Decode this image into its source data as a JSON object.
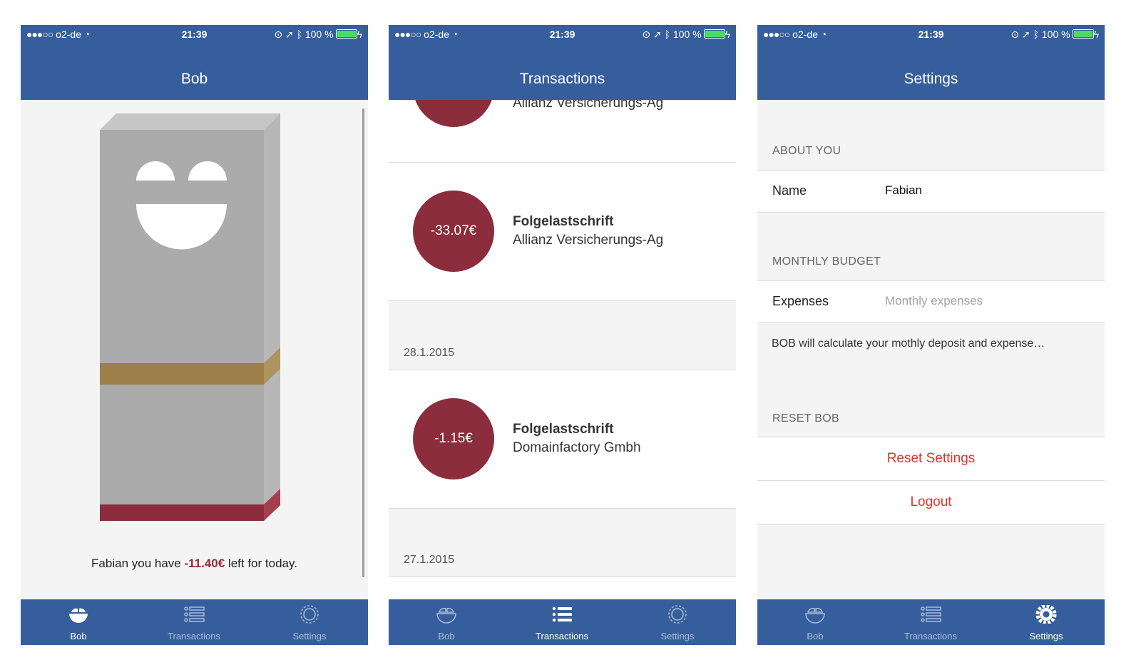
{
  "colors": {
    "brand": "#375e9c",
    "tab_inactive": "#a9bcdb",
    "negative": "#8b2d3c",
    "destructive": "#e0332f",
    "battery": "#4cd964"
  },
  "status_bar": {
    "signal": "●●●○○",
    "carrier": "o2-de",
    "time": "21:39",
    "battery_text": "100 %"
  },
  "tabs": {
    "bob": "Bob",
    "transactions": "Transactions",
    "settings": "Settings"
  },
  "bob_screen": {
    "title": "Bob",
    "message_prefix": "Fabian you have ",
    "amount": "-11.40€",
    "message_suffix": " left for today."
  },
  "transactions_screen": {
    "title": "Transactions",
    "items": [
      {
        "amount": "",
        "type": "",
        "merchant": "Allianz Versicherungs-Ag"
      },
      {
        "amount": "-33.07€",
        "type": "Folgelastschrift",
        "merchant": "Allianz Versicherungs-Ag"
      },
      {
        "date": "28.1.2015"
      },
      {
        "amount": "-1.15€",
        "type": "Folgelastschrift",
        "merchant": "Domainfactory Gmbh"
      },
      {
        "date": "27.1.2015"
      }
    ]
  },
  "settings_screen": {
    "title": "Settings",
    "about_header": "ABOUT YOU",
    "name_label": "Name",
    "name_value": "Fabian",
    "budget_header": "MONTHLY BUDGET",
    "expenses_label": "Expenses",
    "expenses_placeholder": "Monthly expenses",
    "note": "BOB will calculate your mothly deposit and expense…",
    "reset_header": "RESET BOB",
    "reset_button": "Reset Settings",
    "logout_button": "Logout"
  }
}
